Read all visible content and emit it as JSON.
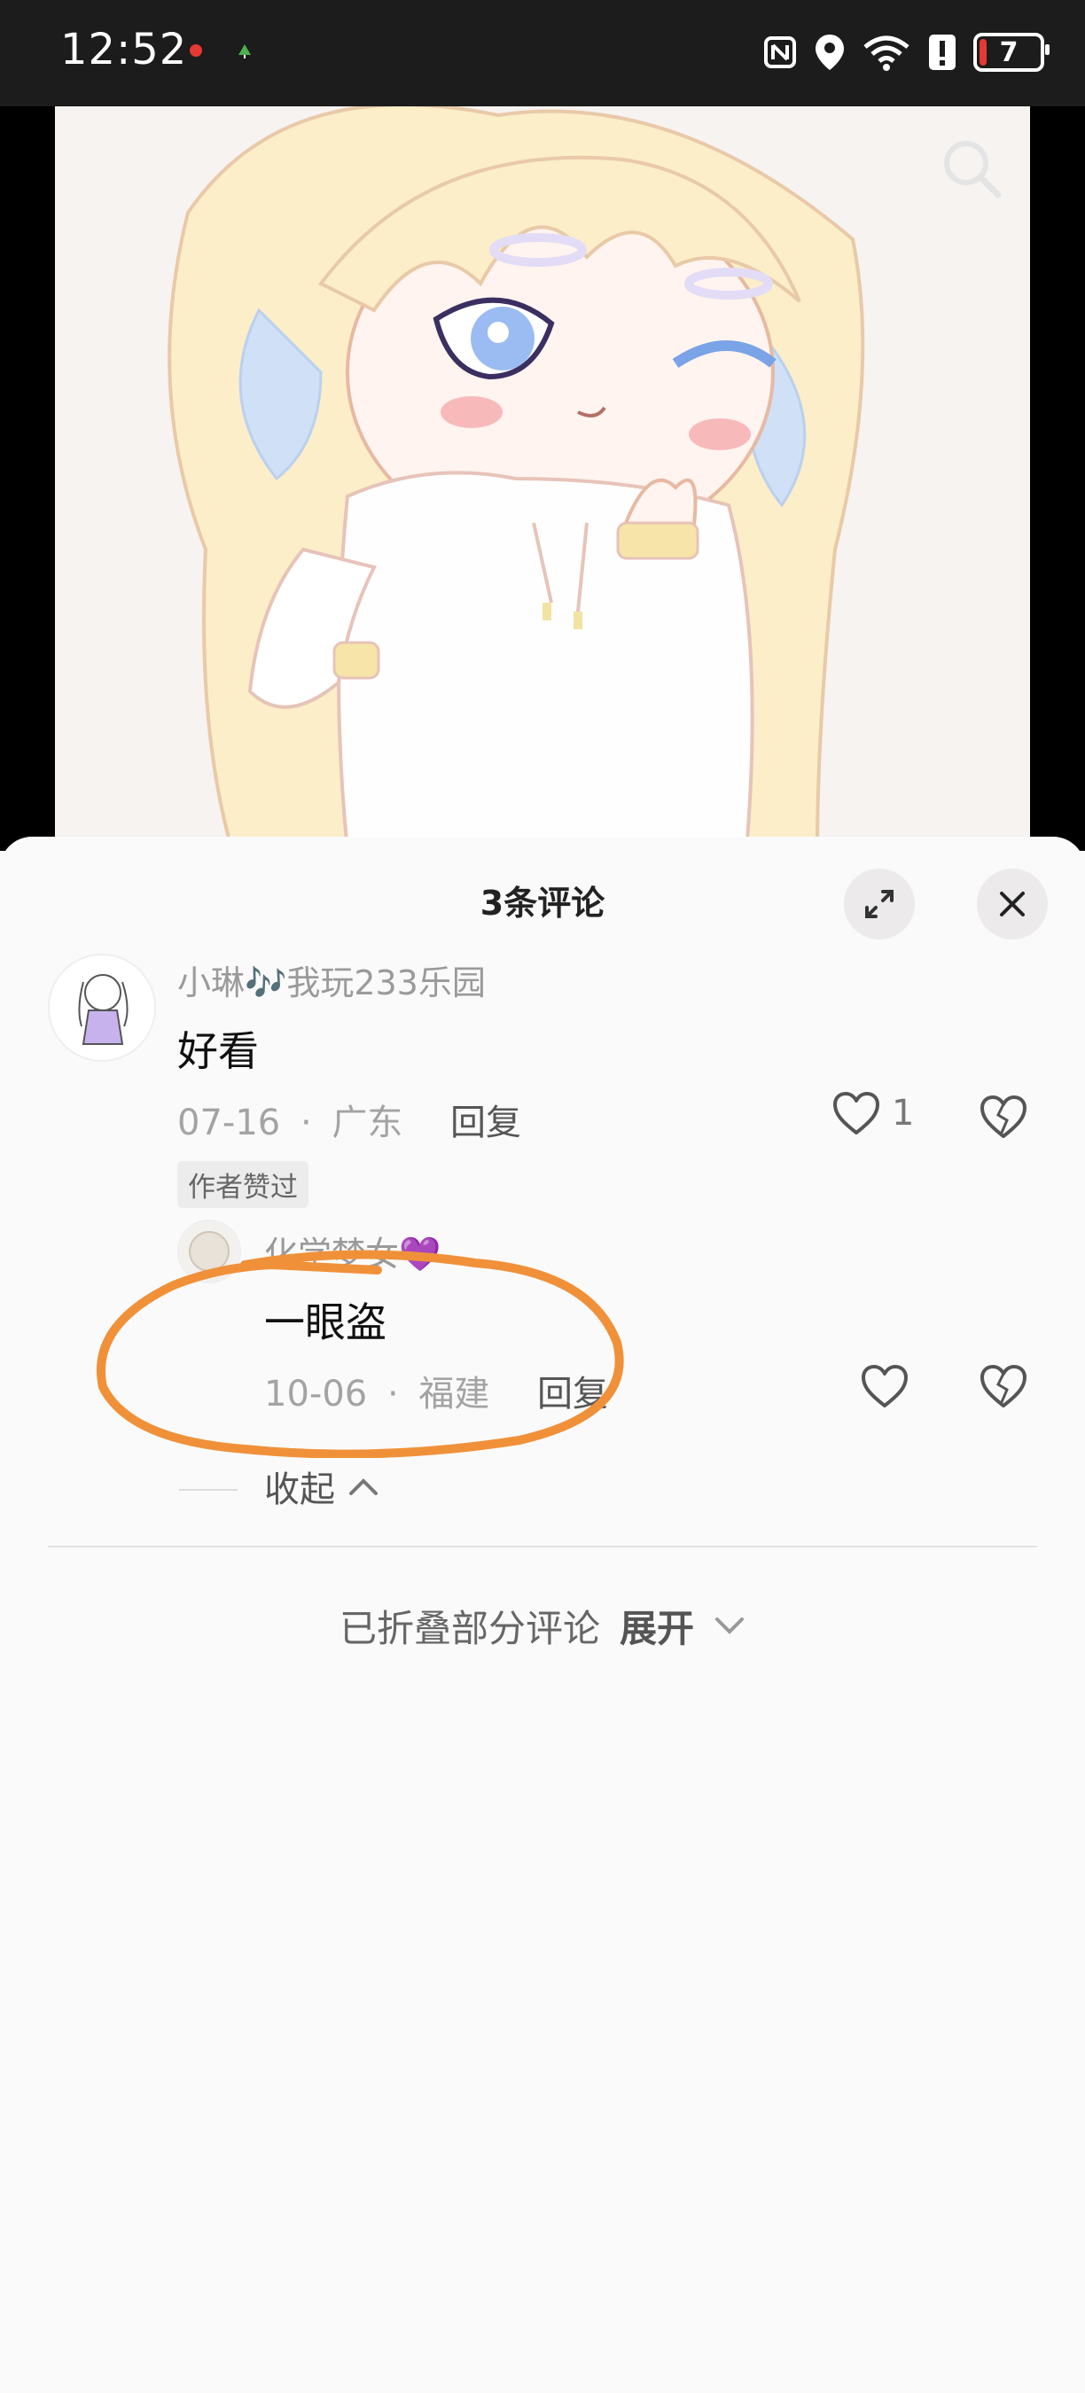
{
  "status_bar": {
    "time": "12:52",
    "battery_level": "7",
    "icons": [
      "notification-red-dot-icon",
      "notification-tree-icon",
      "nfc-icon",
      "location-icon",
      "wifi-icon",
      "alert-icon",
      "battery-icon"
    ]
  },
  "video": {
    "search_icon": "search-icon"
  },
  "comments_panel": {
    "title": "3条评论",
    "expand_icon": "expand-icon",
    "close_icon": "close-icon",
    "comments": [
      {
        "username": "小琳🎶我玩233乐园",
        "text": "好看",
        "date": "07-16",
        "location": "广东",
        "separator": "·",
        "reply_label": "回复",
        "like_count": "1",
        "tag": "作者赞过"
      }
    ],
    "replies": [
      {
        "username": "化学梦女💜",
        "text": "一眼盗",
        "date": "10-06",
        "location": "福建",
        "separator": "·",
        "reply_label": "回复"
      }
    ],
    "collapse_label": "收起",
    "folded_text": "已折叠部分评论",
    "expand_label": "展开"
  },
  "colors": {
    "annotation_circle": "#f0913a",
    "battery_low": "#e53935"
  }
}
